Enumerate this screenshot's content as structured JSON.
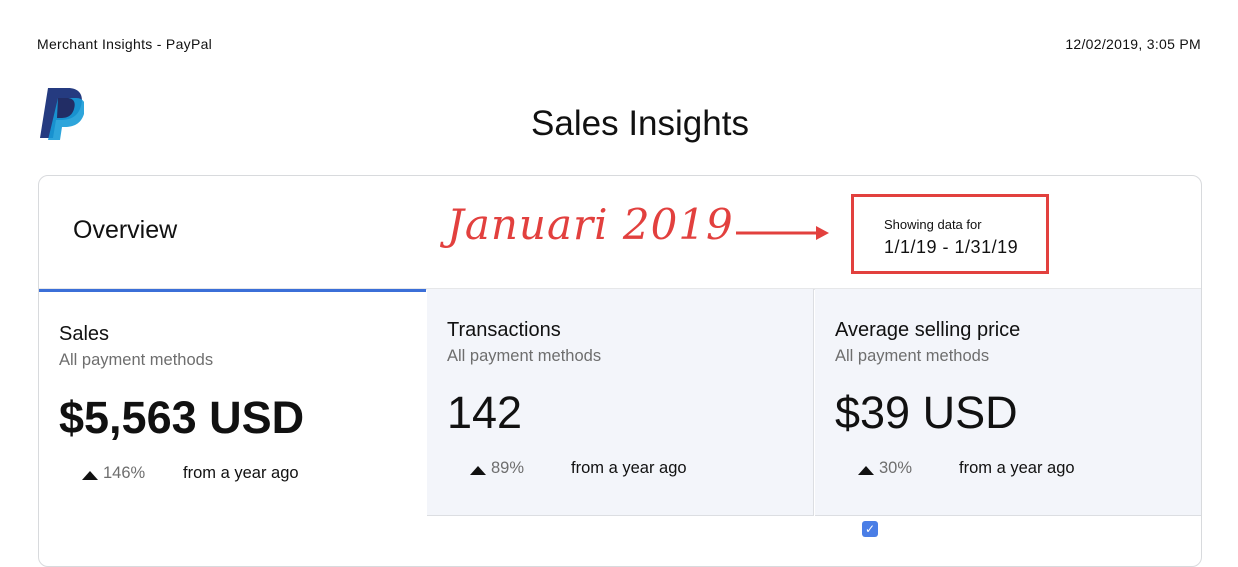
{
  "header": {
    "title": "Merchant Insights - PayPal",
    "timestamp": "12/02/2019, 3:05 PM"
  },
  "page": {
    "title": "Sales Insights"
  },
  "overview": {
    "label": "Overview",
    "annotation": "Januari 2019",
    "date_box": {
      "label": "Showing data for",
      "range": "1/1/19 - 1/31/19"
    }
  },
  "metrics": [
    {
      "title": "Sales",
      "subtitle": "All payment methods",
      "value": "$5,563 USD",
      "change": "146%",
      "change_text": "from a year ago"
    },
    {
      "title": "Transactions",
      "subtitle": "All payment methods",
      "value": "142",
      "change": "89%",
      "change_text": "from a year ago"
    },
    {
      "title": "Average selling price",
      "subtitle": "All payment methods",
      "value": "$39 USD",
      "change": "30%",
      "change_text": "from a year ago"
    }
  ],
  "colors": {
    "accent_blue": "#3b6fd8",
    "annotation_red": "#e2403e",
    "tile_bg": "#f3f5fa"
  },
  "icons": {
    "logo": "paypal-logo",
    "trend": "triangle-up-icon",
    "checkbox": "checkbox-checked-icon"
  }
}
